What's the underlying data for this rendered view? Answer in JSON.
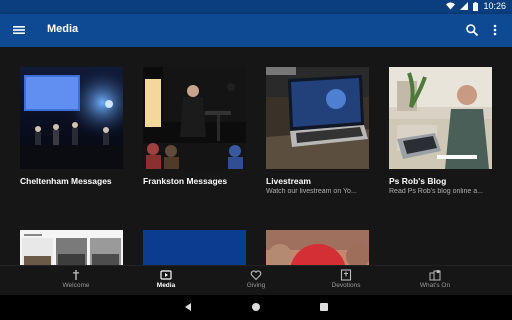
{
  "status_bar": {
    "time": "10:26",
    "icons": [
      "wifi-icon",
      "signal-icon",
      "battery-icon"
    ]
  },
  "app_bar": {
    "title": "Media",
    "menu_icon": "hamburger-menu-icon",
    "search_icon": "search-icon",
    "more_icon": "more-vert-icon",
    "color": "#0e4a94"
  },
  "cards": [
    {
      "title": "Cheltenham Messages",
      "subtitle": ""
    },
    {
      "title": "Frankston Messages",
      "subtitle": ""
    },
    {
      "title": "Livestream",
      "subtitle": "Watch our livestream on Yo..."
    },
    {
      "title": "Ps Rob's Blog",
      "subtitle": "Read Ps Rob's blog online a..."
    }
  ],
  "bottom_nav": {
    "items": [
      {
        "label": "Welcome",
        "icon": "cross-icon"
      },
      {
        "label": "Media",
        "icon": "play-icon",
        "active": true
      },
      {
        "label": "Giving",
        "icon": "heart-icon"
      },
      {
        "label": "Devotions",
        "icon": "bible-icon"
      },
      {
        "label": "What's On",
        "icon": "building-icon"
      }
    ]
  },
  "system_nav": [
    "back-icon",
    "home-icon",
    "recents-icon"
  ]
}
